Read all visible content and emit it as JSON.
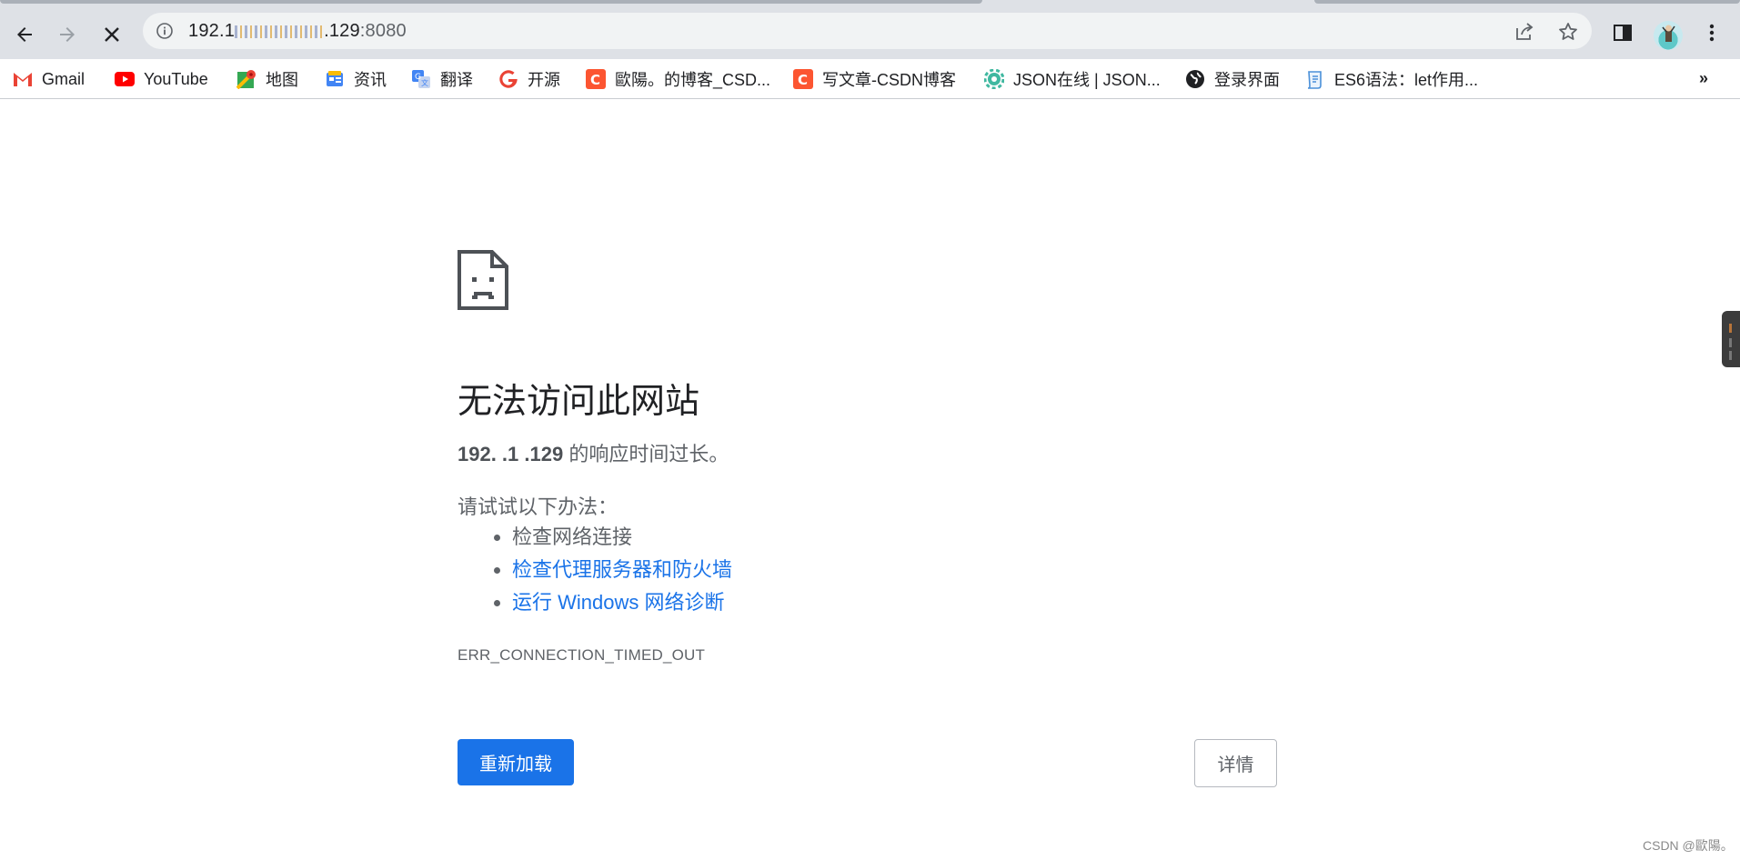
{
  "browser": {
    "url": {
      "host_prefix": "192.1",
      "host_suffix": ".129",
      "port": ":8080"
    },
    "bookmarks": [
      {
        "label": "Gmail",
        "icon": "gmail-icon",
        "color": "#ea4335"
      },
      {
        "label": "YouTube",
        "icon": "youtube-icon",
        "color": "#ff0000"
      },
      {
        "label": "地图",
        "icon": "maps-icon",
        "color": "#34a853"
      },
      {
        "label": "资讯",
        "icon": "news-icon",
        "color": "#4285f4"
      },
      {
        "label": "翻译",
        "icon": "translate-icon",
        "color": "#4285f4"
      },
      {
        "label": "开源",
        "icon": "google-icon",
        "color": "#ea4335"
      },
      {
        "label": "歐陽。的博客_CSD...",
        "icon": "csdn-icon",
        "color": "#fc5531"
      },
      {
        "label": "写文章-CSDN博客",
        "icon": "csdn-icon",
        "color": "#fc5531"
      },
      {
        "label": "JSON在线 | JSON...",
        "icon": "json-gear-icon",
        "color": "#3fb8a0"
      },
      {
        "label": "登录界面",
        "icon": "globe-icon",
        "color": "#202124"
      },
      {
        "label": "ES6语法：let作用...",
        "icon": "doc-icon",
        "color": "#4a90d9"
      }
    ],
    "more_label": "»"
  },
  "error_page": {
    "title": "无法访问此网站",
    "host": "192.   .1  .129",
    "description": " 的响应时间过长。",
    "try_label": "请试试以下办法：",
    "suggestions": [
      {
        "text": "检查网络连接",
        "is_link": false
      },
      {
        "text": "检查代理服务器和防火墙",
        "is_link": true
      },
      {
        "text": "运行 Windows 网络诊断",
        "is_link": true
      }
    ],
    "error_code": "ERR_CONNECTION_TIMED_OUT",
    "reload_label": "重新加载",
    "details_label": "详情",
    "accent_color": "#1a73e8"
  },
  "watermark": "CSDN @歐陽。"
}
